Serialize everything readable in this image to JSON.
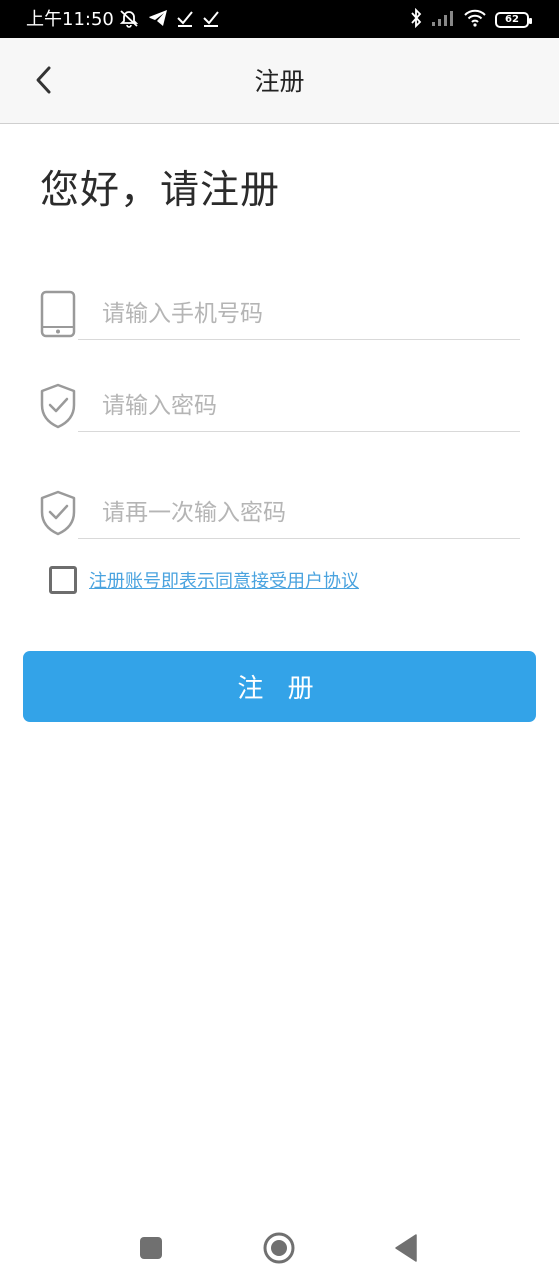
{
  "status_bar": {
    "time": "上午11:50",
    "battery_level": "62",
    "icons": [
      "mute-alarm-icon",
      "telegram-icon",
      "check-icon",
      "check-icon",
      "bluetooth-icon",
      "signal-icon",
      "wifi-icon",
      "battery-icon"
    ]
  },
  "nav": {
    "title": "注册",
    "back_icon": "chevron-left-icon"
  },
  "main": {
    "greeting": "您好，请注册",
    "phone": {
      "placeholder": "请输入手机号码",
      "value": "",
      "icon": "phone-icon"
    },
    "password": {
      "placeholder": "请输入密码",
      "value": "",
      "icon": "shield-check-icon"
    },
    "confirm_password": {
      "placeholder": "请再一次输入密码",
      "value": "",
      "icon": "shield-check-icon"
    },
    "agreement": {
      "checked": false,
      "text": "注册账号即表示同意接受用户协议"
    },
    "submit_label": "注 册"
  },
  "colors": {
    "accent": "#33a3e8",
    "link": "#4aa3df",
    "icon_gray": "#9a9a9a"
  },
  "system_nav": [
    "recents-icon",
    "home-icon",
    "back-icon"
  ]
}
